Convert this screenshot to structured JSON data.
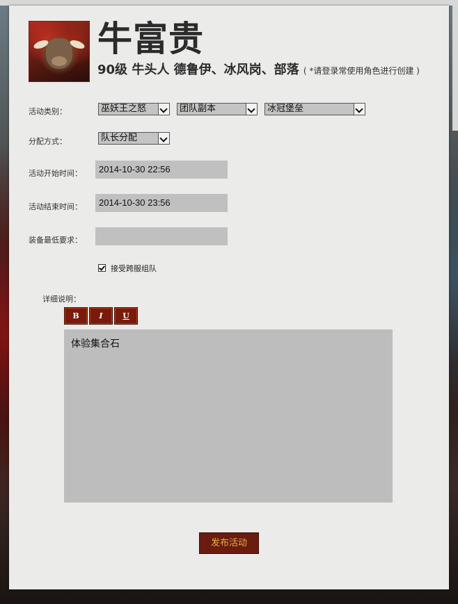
{
  "character": {
    "name": "牛富贵",
    "info": "90级  牛头人  德鲁伊、冰风岗、部落",
    "hint": "( *请登录常使用角色进行创建 )",
    "avatar_icon": "tauren-avatar"
  },
  "form": {
    "category": {
      "label": "活动类别：",
      "select1": "巫妖王之怒",
      "select2": "团队副本",
      "select3": "冰冠堡垒"
    },
    "distribution": {
      "label": "分配方式：",
      "value": "队长分配"
    },
    "start_time": {
      "label": "活动开始时间：",
      "value": "2014-10-30 22:56"
    },
    "end_time": {
      "label": "活动结束时间：",
      "value": "2014-10-30 23:56"
    },
    "min_gear": {
      "label": "装备最低要求：",
      "value": ""
    },
    "cross_server": {
      "label": "接受跨服组队",
      "checked": true
    },
    "description": {
      "label": "详细说明：",
      "bold": "B",
      "italic": "I",
      "underline": "U",
      "text": "体验集合石"
    },
    "submit_label": "发布活动"
  },
  "colors": {
    "button_bg": "#7a1a0a",
    "submit_text": "#e8b040",
    "panel_bg": "#ebebe9",
    "field_bg": "#c0c0c0"
  }
}
